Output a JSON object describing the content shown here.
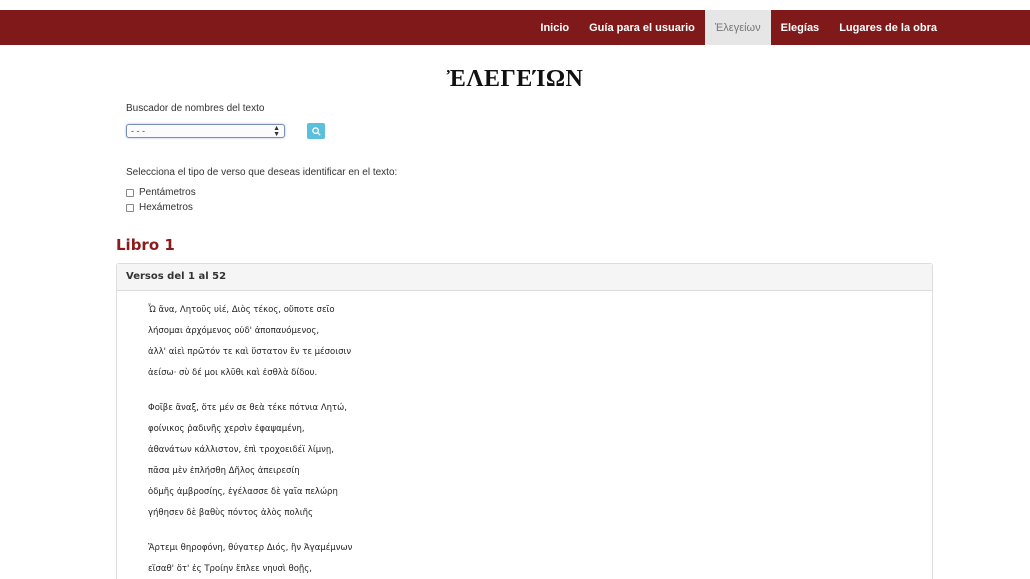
{
  "nav": {
    "items": [
      {
        "label": "Inicio",
        "active": false
      },
      {
        "label": "Guía para el usuario",
        "active": false
      },
      {
        "label": "Ἐλεγείων",
        "active": true
      },
      {
        "label": "Elegías",
        "active": false
      },
      {
        "label": "Lugares de la obra",
        "active": false
      }
    ]
  },
  "page_title": "ἘΛΕΓΕΊΩΝ",
  "search": {
    "label": "Buscador de nombres del texto",
    "selected": "- - -",
    "button_icon": "search-icon"
  },
  "verse_type": {
    "label": "Selecciona el tipo de verso que deseas identificar en el texto:",
    "options": [
      "Pentámetros",
      "Hexámetros"
    ]
  },
  "book": {
    "heading": "Libro 1",
    "panel_title": "Versos del 1 al 52",
    "stanzas": [
      [
        "Ὦ ἄνα, Λητοῦς υἱέ, Διὸς τέκος, οὔποτε σεῖο",
        "λήσομαι ἀρχόμενος οὐδ' ἀποπαυόμενος,",
        "ἀλλ' αἰεὶ πρῶτόν τε καὶ ὕστατον ἔν τε μέσοισιν",
        "ἀείσω· σὺ δέ μοι κλῦθι καὶ ἐσθλὰ δίδου."
      ],
      [
        "Φοῖβε ἄναξ, ὅτε μέν σε θεὰ τέκε πότνια Λητώ,",
        "φοίνικος ῥαδινῆς χερσὶν ἐφαψαμένη,",
        "ἀθανάτων κάλλιστον, ἐπὶ τροχοειδέϊ λίμνῃ,",
        "πᾶσα μὲν ἐπλήσθη Δῆλος ἀπειρεσίη",
        "ὀδμῆς ἀμβροσίης, ἐγέλασσε δὲ γαῖα πελώρη",
        "γήθησεν δὲ βαθὺς πόντος ἁλὸς πολιῆς"
      ],
      [
        "Ἄρτεμι θηροφόνη, θύγατερ Διός, ἣν Ἀγαμέμνων",
        "εἵσαθ' ὅτ' ἐς Τροίην ἔπλεε νηυσὶ θοῇς,"
      ]
    ]
  }
}
